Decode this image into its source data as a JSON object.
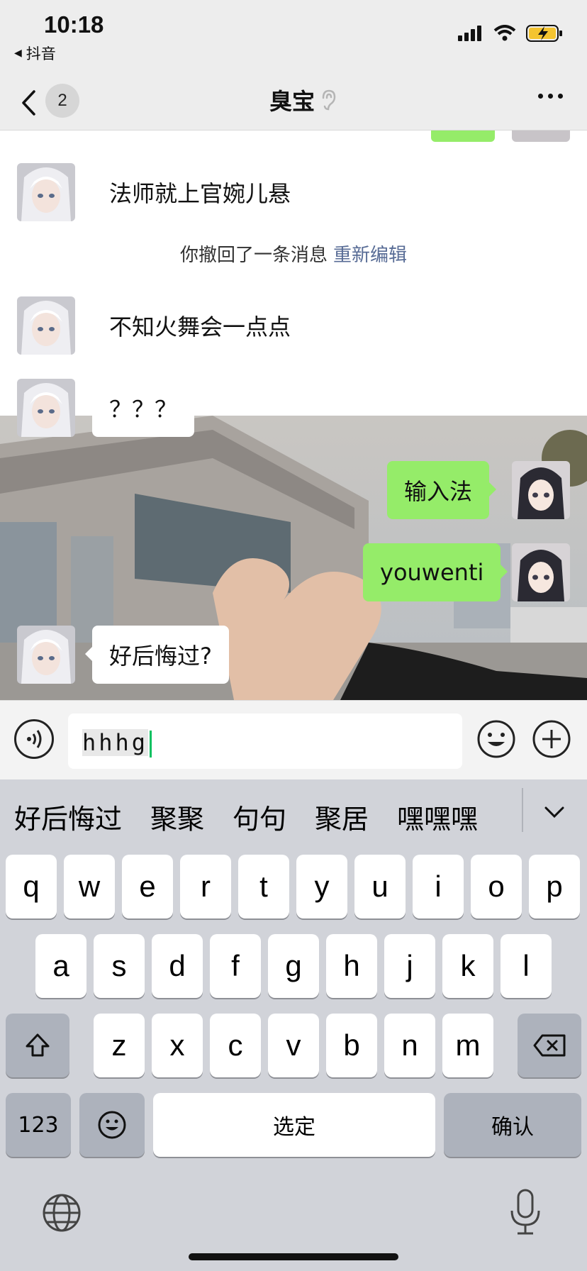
{
  "status_bar": {
    "time": "10:18",
    "back_app": "抖音"
  },
  "nav": {
    "unread_count": "2",
    "title": "臭宝"
  },
  "messages": [
    {
      "side": "left",
      "text": "法师就上官婉儿悬"
    },
    {
      "type": "system",
      "text": "你撤回了一条消息",
      "action": "重新编辑"
    },
    {
      "side": "left",
      "text": "不知火舞会一点点"
    },
    {
      "side": "left",
      "text": "？？？"
    },
    {
      "side": "right",
      "text": "输入法"
    },
    {
      "side": "right",
      "text": "youwenti"
    },
    {
      "side": "left",
      "text": "好后悔过?"
    }
  ],
  "input": {
    "value": "hhhg"
  },
  "keyboard": {
    "candidates": [
      "好后悔过",
      "聚聚",
      "句句",
      "聚居",
      "嘿嘿嘿"
    ],
    "row1": [
      "q",
      "w",
      "e",
      "r",
      "t",
      "y",
      "u",
      "i",
      "o",
      "p"
    ],
    "row2": [
      "a",
      "s",
      "d",
      "f",
      "g",
      "h",
      "j",
      "k",
      "l"
    ],
    "row3": [
      "z",
      "x",
      "c",
      "v",
      "b",
      "n",
      "m"
    ],
    "numbers_label": "123",
    "space_label": "选定",
    "confirm_label": "确认"
  },
  "colors": {
    "outgoing_bubble": "#95ec69",
    "link": "#576b95",
    "caret": "#07c160"
  }
}
